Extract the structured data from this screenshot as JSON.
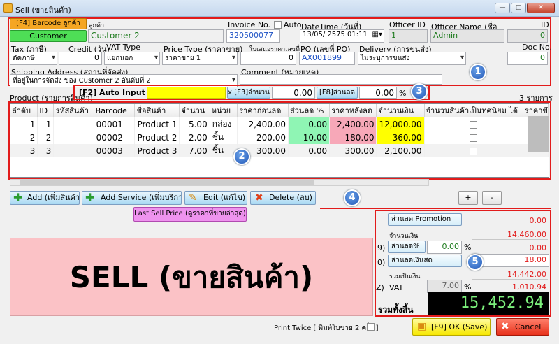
{
  "window": {
    "title": "Sell (ขายสินค้า)"
  },
  "header": {
    "barcode_button": "[F4] Barcode ลูกค้า",
    "customer_label": "ลูกค้า",
    "customer_button": "Customer",
    "customer_value": "Customer 2",
    "invoice_label": "Invoice No.",
    "invoice_value": "320500077",
    "auto_label": "Auto",
    "datetime_label": "DateTime (วันที่)",
    "datetime_value": "13/05/ 2575 01:11",
    "officer_id_label": "Officer ID",
    "officer_id_value": "1",
    "officer_name_label": "Officer Name (ชื่อ",
    "officer_name_value": "Admin",
    "id_label": "ID",
    "id_value": "0",
    "tax_label": "Tax (ภาษี)",
    "tax_value": "ตัดภาษี",
    "credit_label": "Credit (วัน)",
    "credit_value": "0",
    "vat_type_label": "VAT Type",
    "vat_type_value": "แยกนอก",
    "price_type_label": "Price Type (ราคาขาย)",
    "price_type_value": "ราคาขาย 1",
    "quote_label": "ใบเสนอราคาเลขที่",
    "quote_value": "0",
    "po_label": "PO (เลขที่ PO)",
    "po_value": "AX001899",
    "delivery_label": "Delivery (การขนส่ง)",
    "delivery_value": "ไม่ระบุการขนส่ง",
    "docno_label": "Doc No.",
    "docno_value": "0",
    "shipping_label": "Shipping Address (สถานที่จัดส่ง)",
    "shipping_value": "ที่อยู่ในการจัดส่ง ของ Customer 2 อันดับที่ 2",
    "comment_label": "Comment (หมายเหตุ)",
    "comment_value": ""
  },
  "autoinput": {
    "section_label": "Product (รายการสินค้า)",
    "f2_label": "[F2] Auto Input =>",
    "f2_value": "",
    "f3_label": "x [F3]จำนวน",
    "f3_value": "0.00",
    "f8_label": "[F8]ส่วนลด",
    "f8_value": "0.00",
    "pct": "%",
    "items_count": "3 รายการ"
  },
  "table": {
    "columns": [
      "ลำดับ",
      "ID",
      "รหัสสินค้า",
      "Barcode",
      "ชื่อสินค้า",
      "จำนวน",
      "หน่วย",
      "ราคาก่อนลด",
      "ส่วนลด %",
      "ราคาหลังลด",
      "จำนวนเงิน",
      "จำนวนสินค้าเป็นทศนิยม ได้",
      "ราคาขึ"
    ],
    "rows": [
      {
        "no": "1",
        "id": "1",
        "code": "",
        "barcode": "00001",
        "name": "Product 1",
        "qty": "5.00",
        "unit": "กล่อง",
        "price": "2,400.00",
        "disc": "0.00",
        "after": "2,400.00",
        "amount": "12,000.00"
      },
      {
        "no": "2",
        "id": "2",
        "code": "",
        "barcode": "00002",
        "name": "Product 2",
        "qty": "2.00",
        "unit": "ชิ้น",
        "price": "200.00",
        "disc": "10.00",
        "after": "180.00",
        "amount": "360.00"
      },
      {
        "no": "3",
        "id": "3",
        "code": "",
        "barcode": "00003",
        "name": "Product 3",
        "qty": "7.00",
        "unit": "ชิ้น",
        "price": "300.00",
        "disc": "0.00",
        "after": "300.00",
        "amount": "2,100.00"
      }
    ]
  },
  "actions": {
    "add": "Add (เพิ่มสินค้า)",
    "add_service": "Add Service (เพิ่มบริการ)",
    "edit": "Edit (แก้ไข)",
    "delete": "Delete (ลบ)",
    "plus": "+",
    "minus": "-",
    "last_price": "Last Sell Price (ดูราคาที่ขายล่าสุด)"
  },
  "sell_banner": "SELL (ขายสินค้า)",
  "totals": {
    "promotion_button": "ส่วนลด Promotion",
    "promotion_value": "0.00",
    "amount_label": "จำนวนเงิน",
    "amount_value": "14,460.00",
    "disc_pct_key": "9)",
    "disc_pct_button": "ส่วนลด%",
    "disc_pct_input": "0.00",
    "disc_pct_sign": "%",
    "disc_pct_value": "0.00",
    "disc_cash_key": "0)",
    "disc_cash_button": "ส่วนลดเงินสด",
    "disc_cash_value": "18.00",
    "subtotal_label": "รวมเป็นเงิน",
    "subtotal_value": "14,442.00",
    "vat_key": "Z)",
    "vat_label": "VAT",
    "vat_rate": "7.00",
    "vat_sign": "%",
    "vat_value": "1,010.94",
    "grand_label": "รวมทั้งสิ้น",
    "grand_value": "15,452.94"
  },
  "footer": {
    "print_twice": "Print Twice [ พิมพ์ใบขาย 2 ครั้ง ]",
    "ok": "[F9] OK (Save)",
    "cancel": "Cancel"
  },
  "callouts": [
    "1",
    "2",
    "3",
    "4",
    "5"
  ],
  "colors": {
    "red_box": "#e21b1b",
    "green_cell": "#8ff5b4",
    "pink_cell": "#f7a8b8",
    "yellow_cell": "#ffff00",
    "sell_panel": "#fbc2c6",
    "grand_text": "#7cf07c"
  }
}
